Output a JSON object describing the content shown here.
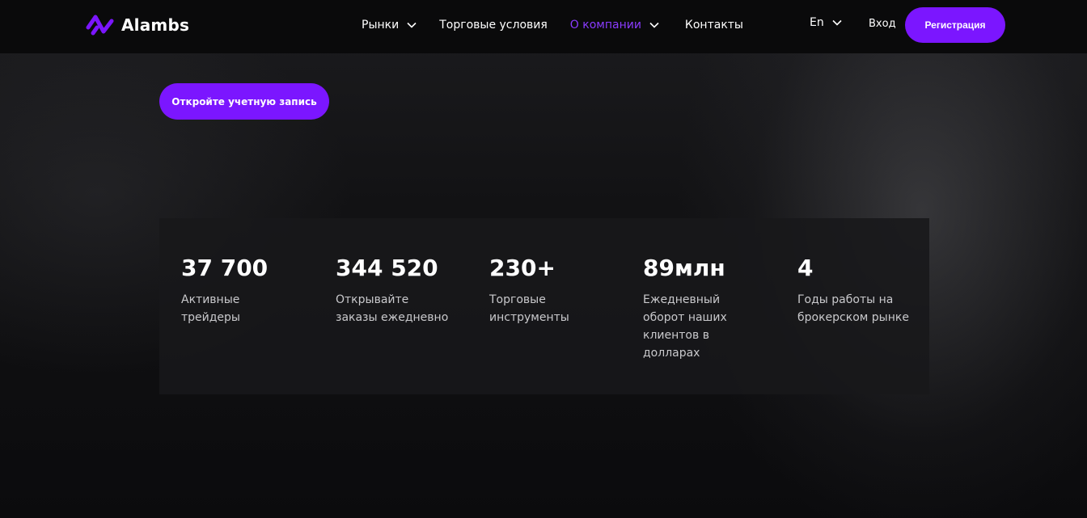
{
  "header": {
    "brand": "Alambs",
    "nav": [
      {
        "label": "Рынки",
        "has_dropdown": true,
        "active": false
      },
      {
        "label": "Торговые условия",
        "has_dropdown": false,
        "active": false
      },
      {
        "label": "О компании",
        "has_dropdown": true,
        "active": true
      },
      {
        "label": "Контакты",
        "has_dropdown": false,
        "active": false
      }
    ],
    "lang": "En",
    "login_label": "Вход",
    "register_label": "Регистрация"
  },
  "hero": {
    "cta_label": "Откройте учетную запись"
  },
  "stats": [
    {
      "value": "37 700",
      "label_lines": [
        "Активные",
        "трейдеры"
      ]
    },
    {
      "value": "344 520",
      "label_lines": [
        "Открывайте",
        "заказы ежедневно"
      ]
    },
    {
      "value": "230+",
      "label_lines": [
        "Торговые",
        "инструменты"
      ]
    },
    {
      "value": "89млн",
      "label_lines": [
        "Ежедневный",
        "оборот наших",
        "клиентов в",
        "долларах"
      ]
    },
    {
      "value": "4",
      "label_lines": [
        "Годы работы на",
        "брокерском рынке"
      ]
    }
  ],
  "colors": {
    "accent": "#7b16ff",
    "active_nav": "#8a3bff",
    "header_bg": "#0a0a0b",
    "stats_bg": "#18181a"
  },
  "icons": {
    "logo": "alambs-logo-icon",
    "dropdown": "chevron-down-icon"
  }
}
